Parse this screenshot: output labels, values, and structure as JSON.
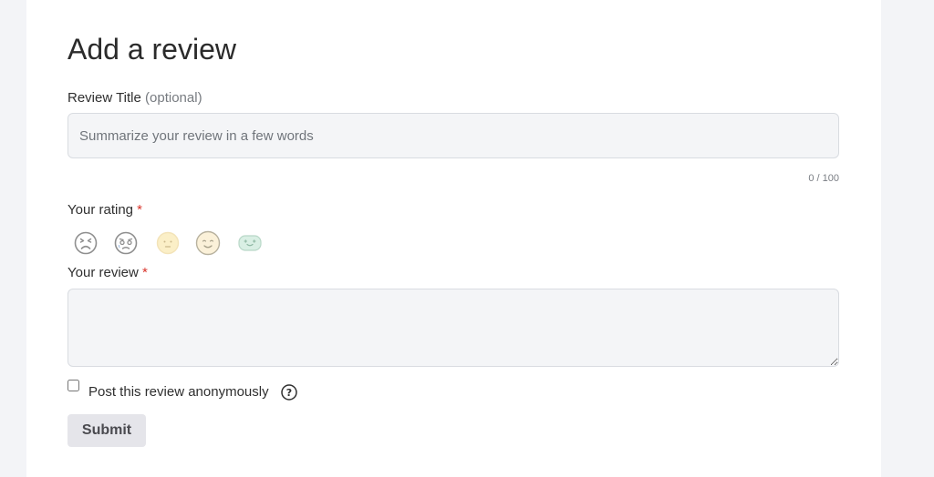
{
  "form": {
    "heading": "Add a review",
    "title_field": {
      "label": "Review Title",
      "optional_note": "(optional)",
      "placeholder": "Summarize your review in a few words",
      "value": "",
      "counter": "0 / 100"
    },
    "rating": {
      "label": "Your rating",
      "required_mark": "*",
      "faces": [
        {
          "icon": "very-dissatisfied-face-icon",
          "color": "#8f8f8f"
        },
        {
          "icon": "dissatisfied-face-icon",
          "color": "#8f8f8f"
        },
        {
          "icon": "neutral-face-icon",
          "color": "#f3e3b8"
        },
        {
          "icon": "satisfied-face-icon",
          "color": "#f1e6c8"
        },
        {
          "icon": "very-satisfied-face-icon",
          "color": "#cfe6dc"
        }
      ],
      "selected": null
    },
    "review_field": {
      "label": "Your review",
      "required_mark": "*",
      "value": ""
    },
    "anonymous": {
      "label": "Post this review anonymously",
      "checked": false,
      "help_icon": "question-circle-icon"
    },
    "submit_label": "Submit"
  },
  "colors": {
    "page_background": "#f3f4f7",
    "card_background": "#ffffff",
    "input_background": "#f4f5f7",
    "required": "#d9342b",
    "button_background": "#e5e5ea"
  }
}
